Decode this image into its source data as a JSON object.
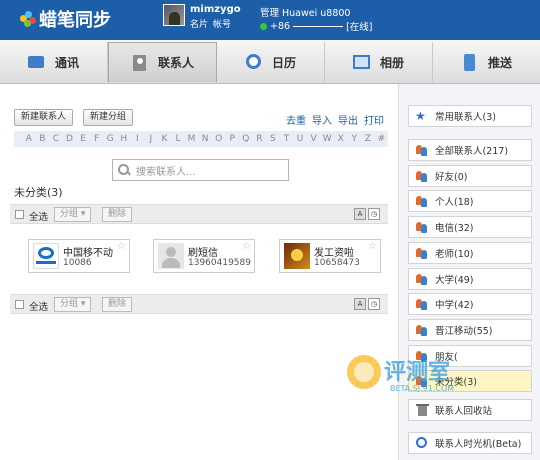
{
  "app": {
    "brand": "蜡笔同步"
  },
  "user": {
    "name": "mimzygo",
    "link_card": "名片",
    "link_account": "帐号",
    "manage_label": "管理 Huawei u8800",
    "phone_masked": "+86",
    "status": "[在线]"
  },
  "tabs": [
    {
      "label": "通讯"
    },
    {
      "label": "联系人"
    },
    {
      "label": "日历"
    },
    {
      "label": "相册"
    },
    {
      "label": "推送"
    }
  ],
  "toolbar": {
    "new_contact": "新建联系人",
    "new_group": "新建分组",
    "dedupe": "去重",
    "import": "导入",
    "export": "导出",
    "print": "打印"
  },
  "alphabet": [
    "A",
    "B",
    "C",
    "D",
    "E",
    "F",
    "G",
    "H",
    "I",
    "J",
    "K",
    "L",
    "M",
    "N",
    "O",
    "P",
    "Q",
    "R",
    "S",
    "T",
    "U",
    "V",
    "W",
    "X",
    "Y",
    "Z",
    "#"
  ],
  "search": {
    "placeholder": "搜索联系人..."
  },
  "group_heading": "未分类(3)",
  "select_bar": {
    "select_all": "全选",
    "group_btn": "分组 ▾",
    "delete_btn": "删除",
    "view_a": "A",
    "view_b": "◷"
  },
  "contacts": [
    {
      "name": "中国移不动",
      "number": "10086"
    },
    {
      "name": "刷短信",
      "number": "13960419589"
    },
    {
      "name": "发工资啦",
      "number": "10658473"
    }
  ],
  "sidebar": {
    "favorites": "常用联系人(3)",
    "groups": [
      "全部联系人(217)",
      "好友(0)",
      "个人(18)",
      "电信(32)",
      "老师(10)",
      "大学(49)",
      "中学(42)",
      "晋江移动(55)",
      "朋友(",
      "未分类(3)"
    ],
    "trash": "联系人回收站",
    "timemachine": "联系人时光机(Beta)"
  },
  "watermark": {
    "title": "评测室",
    "sub": "BETA.SJ.91.COM"
  },
  "colors": {
    "header": "#1c5fa8",
    "link": "#1a5fb4",
    "selected_group": "#fdf6c4"
  }
}
